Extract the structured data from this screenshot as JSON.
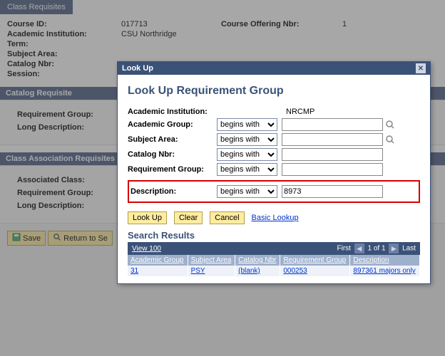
{
  "background": {
    "tab_title": "Class Requisites",
    "fields": {
      "course_id_label": "Course ID:",
      "course_id_value": "017713",
      "offering_label": "Course Offering Nbr:",
      "offering_value": "1",
      "academic_inst_label": "Academic Institution:",
      "academic_inst_value": "CSU Northridge",
      "term_label": "Term:",
      "subject_area_label": "Subject Area:",
      "catalog_nbr_label": "Catalog Nbr:",
      "session_label": "Session:"
    },
    "catalog_requisite": {
      "title": "Catalog Requisite",
      "req_group_label": "Requirement Group:",
      "long_desc_label": "Long Description:"
    },
    "class_assoc": {
      "title": "Class Association Requisites",
      "assoc_class_label": "Associated Class:",
      "req_group_label": "Requirement Group:",
      "long_desc_label": "Long Description:"
    },
    "buttons": {
      "save": "Save",
      "return": "Return to Se"
    }
  },
  "modal": {
    "title": "Look Up",
    "heading": "Look Up Requirement Group",
    "filters": {
      "academic_institution": {
        "label": "Academic Institution:",
        "value": "NRCMP"
      },
      "academic_group": {
        "label": "Academic Group:",
        "op": "begins with",
        "value": ""
      },
      "subject_area": {
        "label": "Subject Area:",
        "op": "begins with",
        "value": ""
      },
      "catalog_nbr": {
        "label": "Catalog Nbr:",
        "op": "begins with",
        "value": ""
      },
      "requirement_group": {
        "label": "Requirement Group:",
        "op": "begins with",
        "value": ""
      },
      "description": {
        "label": "Description:",
        "op": "begins with",
        "value": "8973"
      }
    },
    "buttons": {
      "lookup": "Look Up",
      "clear": "Clear",
      "cancel": "Cancel",
      "basic_lookup": "Basic Lookup"
    },
    "results": {
      "heading": "Search Results",
      "view_label": "View 100",
      "nav": {
        "first": "First",
        "pos": "1 of 1",
        "last": "Last"
      },
      "headers": [
        "Academic Group",
        "Subject Area",
        "Catalog Nbr",
        "Requirement Group",
        "Description"
      ],
      "rows": [
        {
          "academic_group": "31",
          "subject_area": "PSY",
          "catalog_nbr": "(blank)",
          "requirement_group": "000253",
          "description": "897361 majors only"
        }
      ]
    }
  }
}
